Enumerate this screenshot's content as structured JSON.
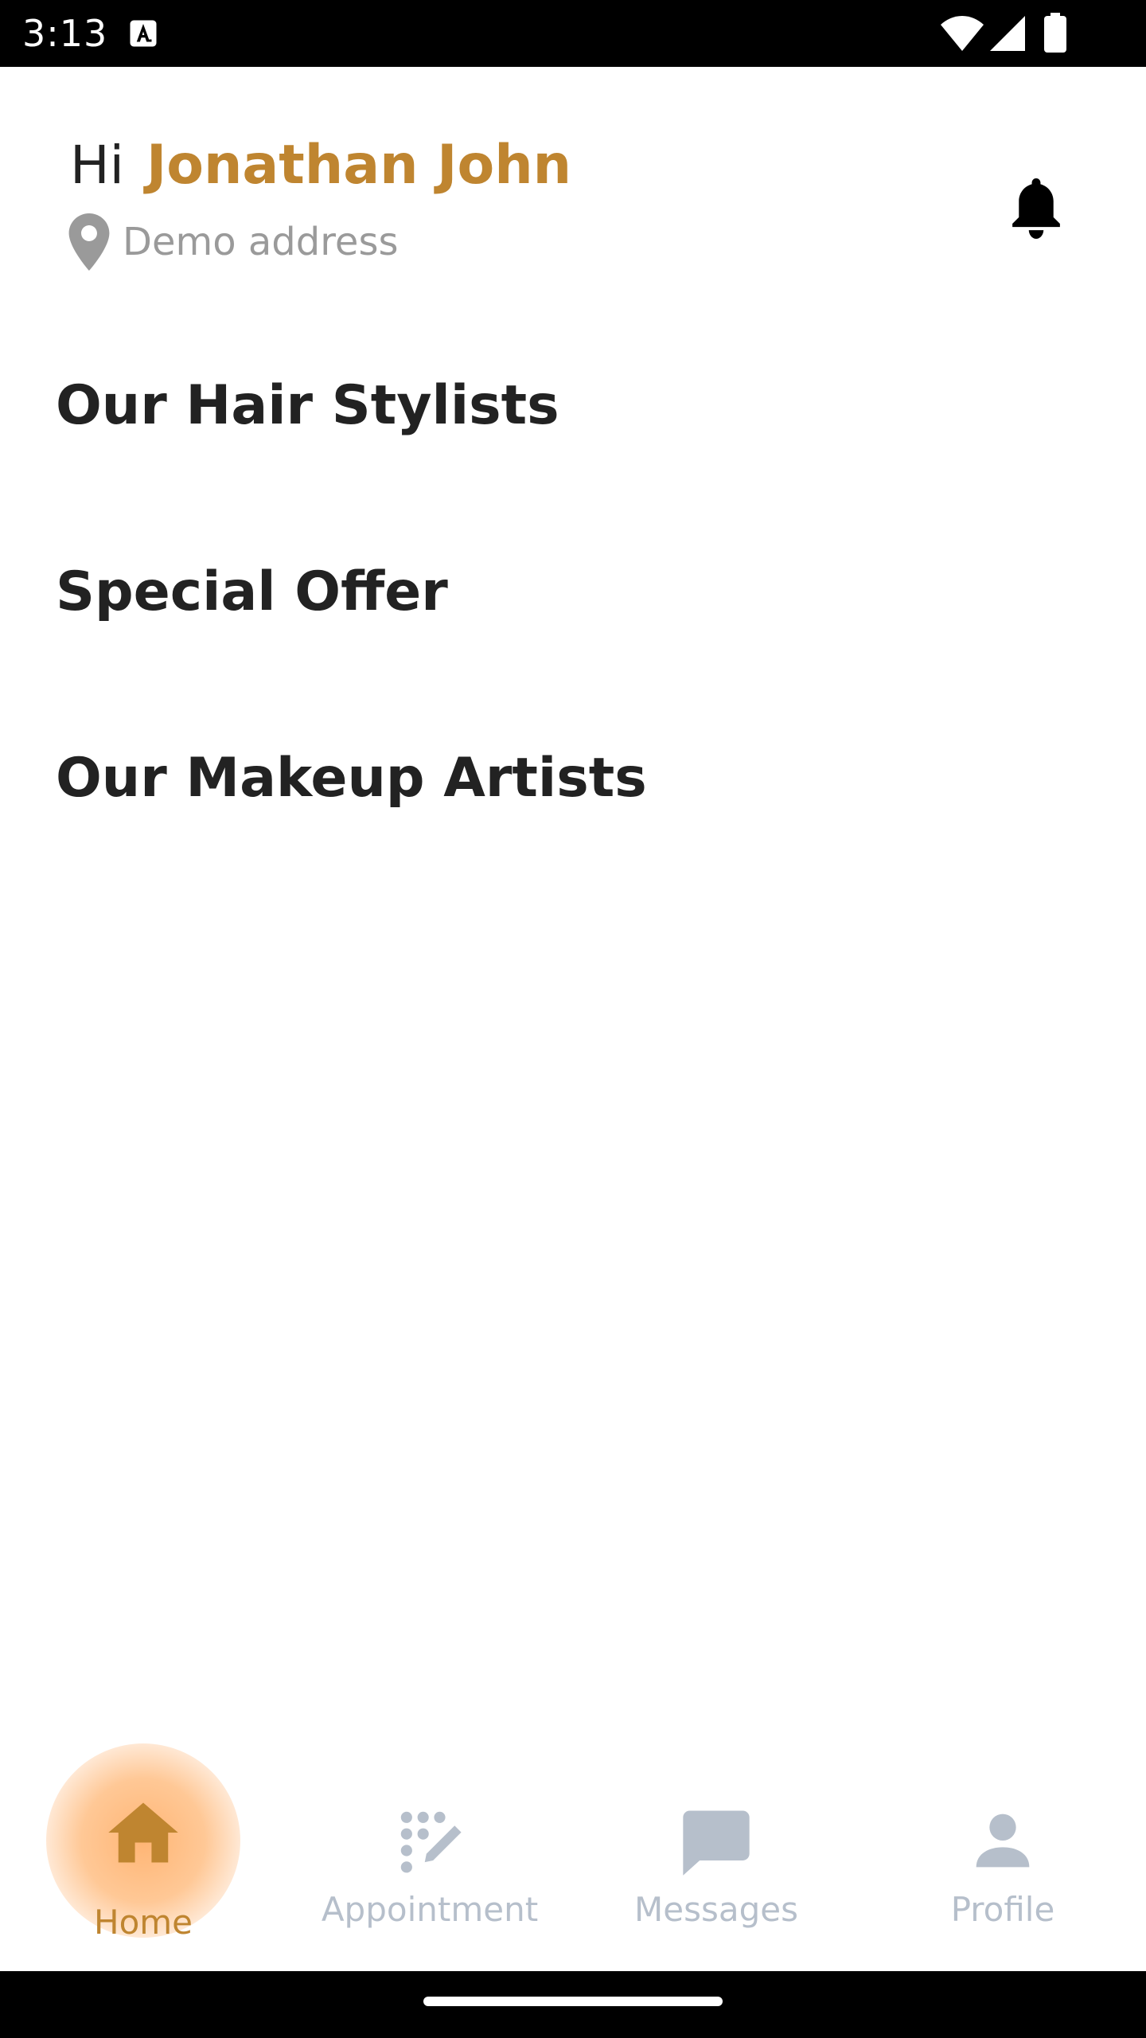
{
  "status_bar": {
    "time": "3:13"
  },
  "header": {
    "greeting": "Hi",
    "user_name": "Jonathan John",
    "address": "Demo address"
  },
  "sections": [
    {
      "title": "Our Hair Stylists"
    },
    {
      "title": "Special Offer"
    },
    {
      "title": "Our Makeup Artists"
    }
  ],
  "bottom_nav": {
    "items": [
      {
        "label": "Home",
        "icon": "home-icon",
        "active": true
      },
      {
        "label": "Appointment",
        "icon": "appointment-icon",
        "active": false
      },
      {
        "label": "Messages",
        "icon": "messages-icon",
        "active": false
      },
      {
        "label": "Profile",
        "icon": "profile-icon",
        "active": false
      }
    ]
  },
  "colors": {
    "accent": "#bf8530",
    "inactive_nav": "#b6bfcb",
    "title_text": "#222222",
    "address_text": "#9a9a9a",
    "home_glow": "#ffb574"
  }
}
